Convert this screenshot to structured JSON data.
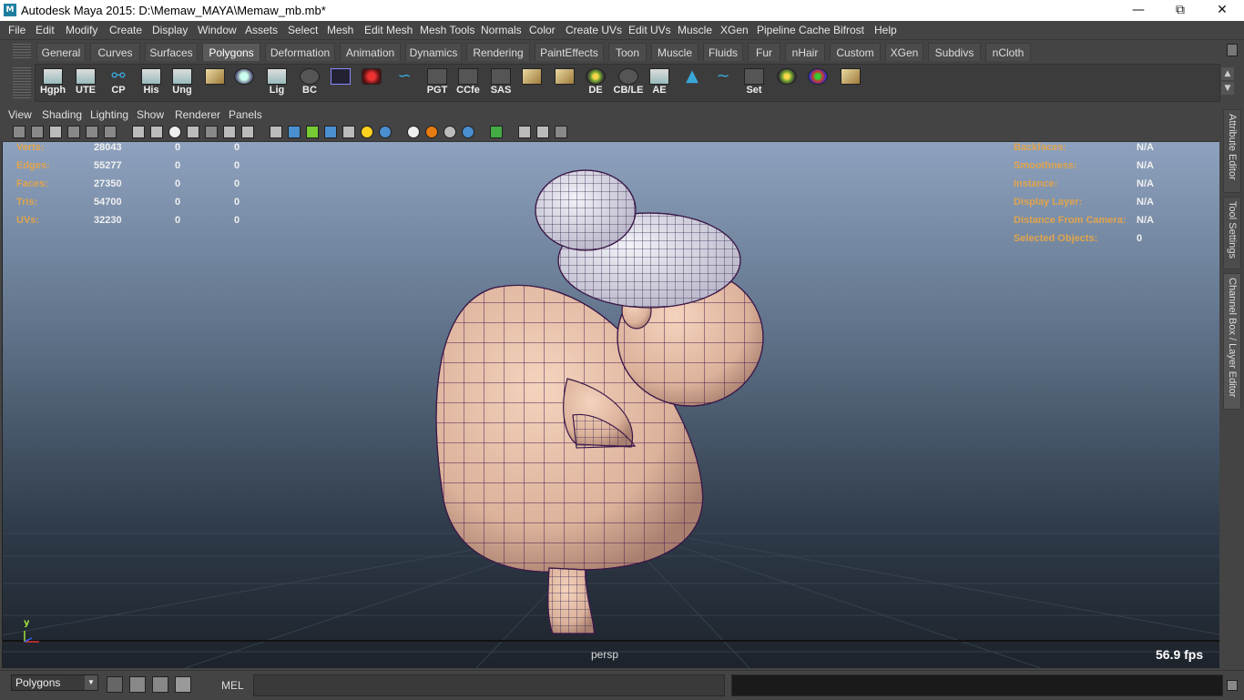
{
  "window": {
    "app_icon": "M",
    "title": "Autodesk Maya 2015: D:\\Memaw_MAYA\\Memaw_mb.mb*",
    "minimize_icon": "minimize-icon",
    "maximize_icon": "restore-icon",
    "close_icon": "close-icon"
  },
  "menu": [
    "File",
    "Edit",
    "Modify",
    "Create",
    "Display",
    "Window",
    "Assets",
    "Select",
    "Mesh",
    "Edit Mesh",
    "Mesh Tools",
    "Normals",
    "Color",
    "Create UVs",
    "Edit UVs",
    "Muscle",
    "XGen",
    "Pipeline Cache",
    "Bifrost",
    "Help"
  ],
  "shelf_tabs": {
    "active": "Polygons",
    "items": [
      "General",
      "Curves",
      "Surfaces",
      "Polygons",
      "Deformation",
      "Animation",
      "Dynamics",
      "Rendering",
      "PaintEffects",
      "Toon",
      "Muscle",
      "Fluids",
      "Fur",
      "nHair",
      "Custom",
      "XGen",
      "Subdivs",
      "nCloth"
    ]
  },
  "shelf_buttons": [
    "Hgph",
    "UTE",
    "CP",
    "His",
    "Ung",
    "",
    "",
    "Lig",
    "BC",
    "",
    "",
    "",
    "PGT",
    "CCfe",
    "SAS",
    "",
    "",
    "DE",
    "CB/LE",
    "AE",
    "",
    "",
    "Set",
    "",
    ""
  ],
  "panel_menu": [
    "View",
    "Shading",
    "Lighting",
    "Show",
    "Renderer",
    "Panels"
  ],
  "hud_left": [
    {
      "label": "Verts:",
      "v1": "28043",
      "v2": "0",
      "v3": "0"
    },
    {
      "label": "Edges:",
      "v1": "55277",
      "v2": "0",
      "v3": "0"
    },
    {
      "label": "Faces:",
      "v1": "27350",
      "v2": "0",
      "v3": "0"
    },
    {
      "label": "Tris:",
      "v1": "54700",
      "v2": "0",
      "v3": "0"
    },
    {
      "label": "UVs:",
      "v1": "32230",
      "v2": "0",
      "v3": "0"
    }
  ],
  "hud_right": [
    {
      "label": "Backfaces:",
      "value": "N/A"
    },
    {
      "label": "Smoothness:",
      "value": "N/A"
    },
    {
      "label": "Instance:",
      "value": "N/A"
    },
    {
      "label": "Display Layer:",
      "value": "N/A"
    },
    {
      "label": "Distance From Camera:",
      "value": "N/A"
    },
    {
      "label": "Selected Objects:",
      "value": "0"
    }
  ],
  "viewport": {
    "camera": "persp",
    "fps": "56.9 fps",
    "axis_label": "y"
  },
  "side_tabs": [
    "Attribute Editor",
    "Tool Settings",
    "Channel Box / Layer Editor"
  ],
  "command": {
    "mode": "Polygons",
    "language": "MEL",
    "input": "",
    "output": ""
  },
  "colors": {
    "hud_label": "#e0a44d",
    "viewport_top": "#8ea2bf",
    "viewport_bottom": "#1d232b",
    "skin": "#e8c2a8",
    "wire": "#3a1a4a"
  }
}
